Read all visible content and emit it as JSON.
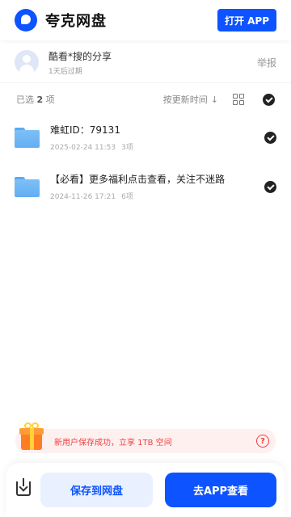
{
  "header": {
    "app_name": "夸克网盘",
    "open_app_label": "打开 APP"
  },
  "sharer": {
    "name": "酷看*搜的分享",
    "expire": "1天后过期",
    "report_label": "举报"
  },
  "toolbar": {
    "selected_prefix": "已选",
    "selected_count": "2",
    "selected_suffix": "项",
    "sort_label": "按更新时间",
    "sort_icon": "arrow-down-icon",
    "view_icon": "grid-view-icon"
  },
  "files": [
    {
      "name": "难虹ID：79131",
      "date": "2025-02-24 11:53",
      "count": "3项",
      "checked": true
    },
    {
      "name": "【必看】更多福利点击查看，关注不迷路",
      "date": "2024-11-26 17:21",
      "count": "6项",
      "checked": true
    }
  ],
  "promo": {
    "text": "新用户保存成功，立享 1TB 空间",
    "help_glyph": "?"
  },
  "bottom": {
    "save_label": "保存到网盘",
    "view_label": "去APP查看"
  },
  "colors": {
    "brand_blue": "#0d53ff",
    "promo_red": "#ef3e3e",
    "promo_bg": "#fff0f0"
  }
}
